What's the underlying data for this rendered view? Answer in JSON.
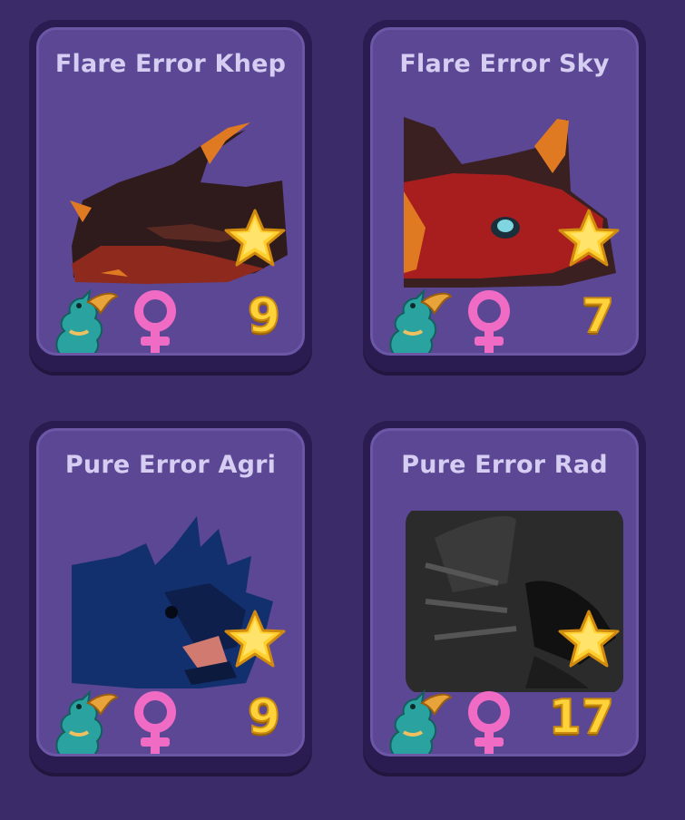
{
  "cards": [
    {
      "name": "Flare Error Khep",
      "level": "9",
      "gender_icon": "female-symbol-icon",
      "stat_icon": "gold-star-icon",
      "type_icon": "teal-dragon-icon",
      "art_colors": [
        "#3a2222",
        "#8c2a1c",
        "#e07a22"
      ]
    },
    {
      "name": "Flare Error Sky",
      "level": "7",
      "gender_icon": "female-symbol-icon",
      "stat_icon": "gold-star-icon",
      "type_icon": "teal-dragon-icon",
      "art_colors": [
        "#a01e1e",
        "#3a2222",
        "#e07a22"
      ]
    },
    {
      "name": "Pure Error Agri",
      "level": "9",
      "gender_icon": "female-symbol-icon",
      "stat_icon": "gold-star-icon",
      "type_icon": "teal-dragon-icon",
      "art_colors": [
        "#12306e",
        "#0d1f4a",
        "#d07a70"
      ]
    },
    {
      "name": "Pure Error Rad",
      "level": "17",
      "gender_icon": "female-symbol-icon",
      "stat_icon": "gold-star-icon",
      "type_icon": "teal-dragon-icon",
      "art_colors": [
        "#2b2b2b",
        "#4a4a4a",
        "#111111"
      ]
    }
  ],
  "colors": {
    "background": "#3b2b68",
    "card": "#5b4794",
    "title_text": "#d6cdf2",
    "level_text": "#ffd23a",
    "female_icon": "#f06bc4"
  }
}
